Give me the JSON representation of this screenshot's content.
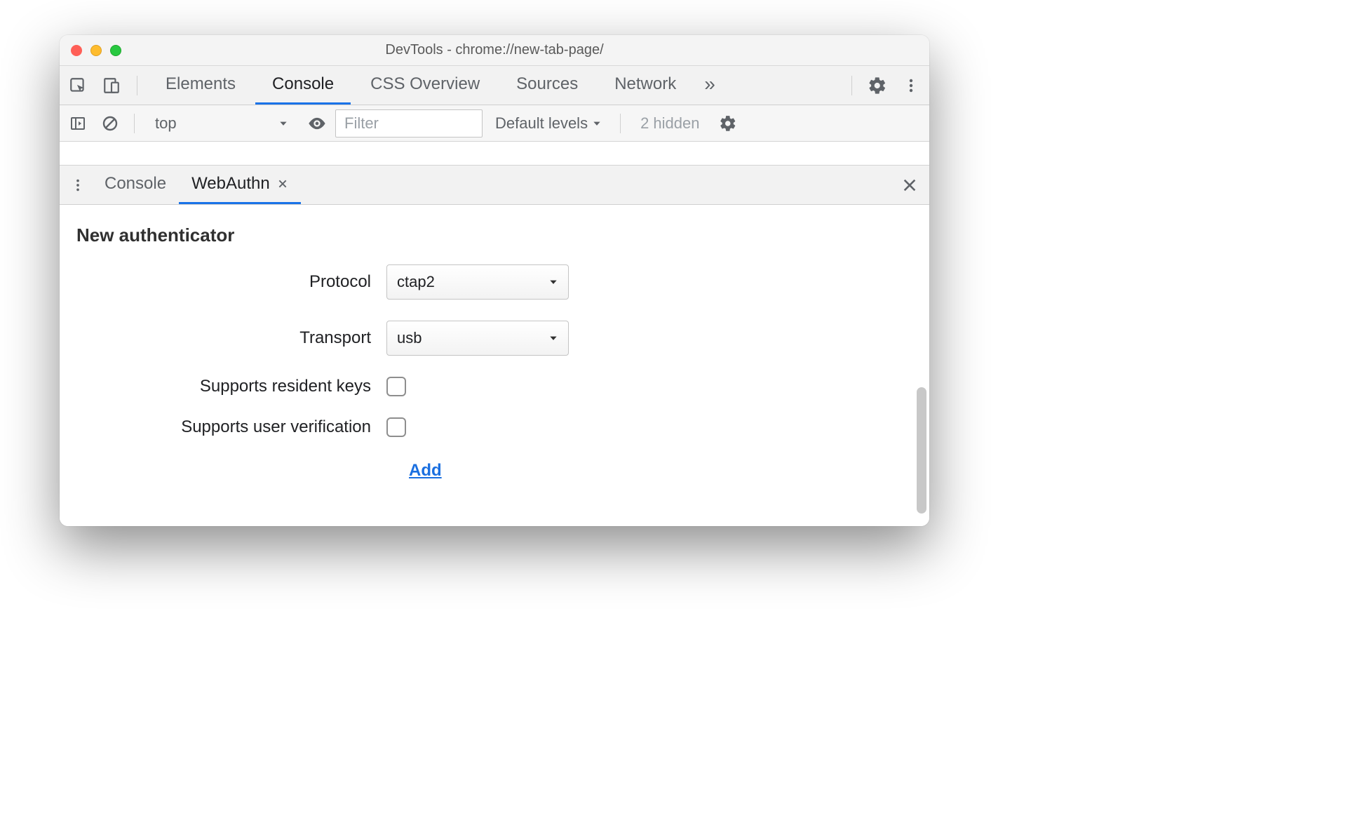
{
  "window": {
    "title": "DevTools - chrome://new-tab-page/"
  },
  "main_tabs": {
    "items": [
      "Elements",
      "Console",
      "CSS Overview",
      "Sources",
      "Network"
    ],
    "active_index": 1,
    "overflow_glyph": "»"
  },
  "console_toolbar": {
    "context": "top",
    "filter_placeholder": "Filter",
    "levels_label": "Default levels",
    "hidden_label": "2 hidden"
  },
  "drawer": {
    "tabs": [
      {
        "label": "Console",
        "closable": false
      },
      {
        "label": "WebAuthn",
        "closable": true
      }
    ],
    "active_index": 1
  },
  "webauthn": {
    "section_title": "New authenticator",
    "labels": {
      "protocol": "Protocol",
      "transport": "Transport",
      "resident_keys": "Supports resident keys",
      "user_verification": "Supports user verification"
    },
    "values": {
      "protocol": "ctap2",
      "transport": "usb",
      "resident_keys": false,
      "user_verification": false
    },
    "add_label": "Add"
  }
}
